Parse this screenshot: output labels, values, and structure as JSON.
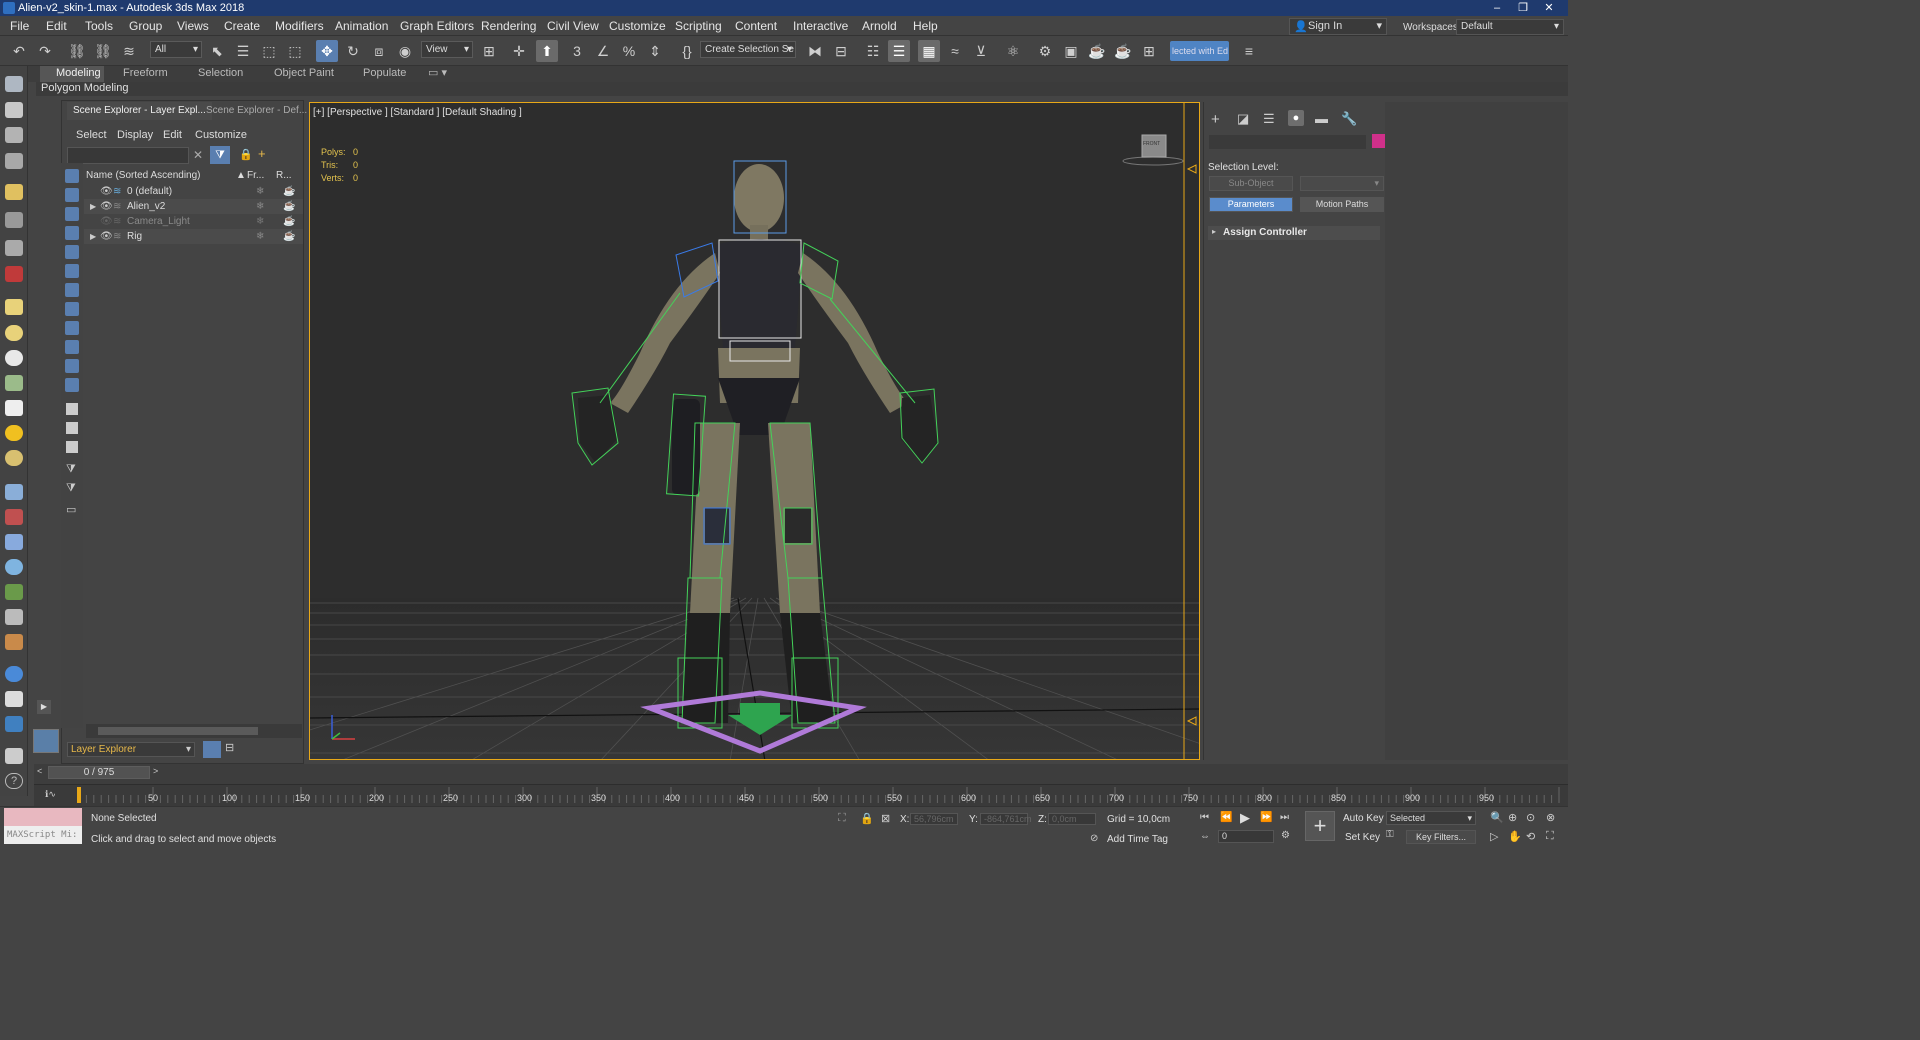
{
  "window": {
    "title": "Alien-v2_skin-1.max - Autodesk 3ds Max 2018",
    "min": "–",
    "restore": "❐",
    "close": "✕"
  },
  "menu": [
    "File",
    "Edit",
    "Tools",
    "Group",
    "Views",
    "Create",
    "Modifiers",
    "Animation",
    "Graph Editors",
    "Rendering",
    "Civil View",
    "Customize",
    "Scripting",
    "Content",
    "Interactive",
    "Arnold",
    "Help"
  ],
  "account": {
    "signin": "Sign In",
    "workspaces_label": "Workspaces:",
    "workspace": "Default"
  },
  "toolbar": {
    "filter": "All",
    "view": "View",
    "selection_set": "Create Selection Se",
    "selected_with": "lected with Ed"
  },
  "ribbon": {
    "tabs": [
      "Modeling",
      "Freeform",
      "Selection",
      "Object Paint",
      "Populate"
    ],
    "panel": "Polygon Modeling"
  },
  "explorer": {
    "tabs": [
      "Scene Explorer - Layer Expl...",
      "Scene Explorer - Def..."
    ],
    "menu": [
      "Select",
      "Display",
      "Edit",
      "Customize"
    ],
    "columns": {
      "name": "Name (Sorted Ascending)",
      "frozen": "Fr...",
      "render": "R..."
    },
    "rows": [
      "0 (default)",
      "Alien_v2",
      "Camera_Light",
      "Rig"
    ],
    "layer_dropdown": "Layer Explorer"
  },
  "viewport": {
    "label": "[+] [Perspective ] [Standard ] [Default Shading ]",
    "stats": {
      "polys_label": "Polys:",
      "polys": "0",
      "tris_label": "Tris:",
      "tris": "0",
      "verts_label": "Verts:",
      "verts": "0"
    },
    "viewcube": "FRONT"
  },
  "command_panel": {
    "selection_level": "Selection Level:",
    "sub_object": "Sub-Object",
    "parameters": "Parameters",
    "motion_paths": "Motion Paths",
    "assign_controller": "Assign Controller"
  },
  "timeline": {
    "frame": "0 / 975",
    "ticks": [
      "50",
      "100",
      "150",
      "200",
      "250",
      "300",
      "350",
      "400",
      "450",
      "500",
      "550",
      "600",
      "650",
      "700",
      "750",
      "800",
      "850",
      "900",
      "950"
    ]
  },
  "status": {
    "maxscript": "MAXScript Mi:",
    "selection": "None Selected",
    "prompt": "Click and drag to select and move objects",
    "x_label": "X:",
    "x": "56,796cm",
    "y_label": "Y:",
    "y": "-864,761cm",
    "z_label": "Z:",
    "z": "0,0cm",
    "grid": "Grid = 10,0cm",
    "add_time_tag": "Add Time Tag",
    "auto_key": "Auto Key",
    "selected": "Selected",
    "set_key": "Set Key",
    "key_filters": "Key Filters...",
    "frame_value": "0"
  },
  "colors": {
    "accent": "#5a7fb0",
    "viewport_border": "#e8a818",
    "stats": "#e3c34e",
    "swatch": "#d0308a"
  }
}
